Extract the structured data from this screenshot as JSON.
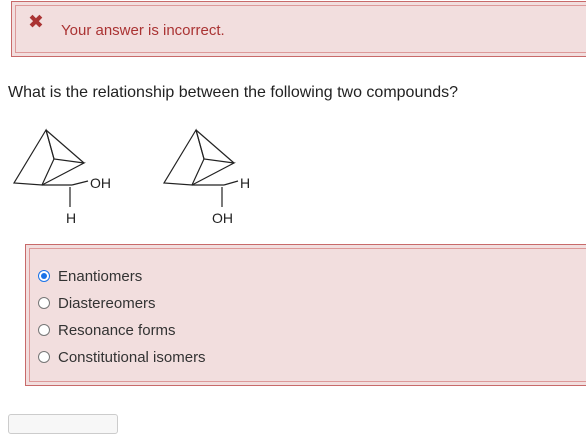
{
  "feedback": {
    "icon": "close-icon",
    "glyph": "✖",
    "text": "Your answer is incorrect."
  },
  "question": {
    "text": "What is the relationship between the following two compounds?"
  },
  "molecules": [
    {
      "top_label": "OH",
      "bottom_label": "H"
    },
    {
      "top_label": "H",
      "bottom_label": "OH"
    }
  ],
  "options": [
    {
      "label": "Enantiomers",
      "selected": true
    },
    {
      "label": "Diastereomers",
      "selected": false
    },
    {
      "label": "Resonance forms",
      "selected": false
    },
    {
      "label": "Constitutional isomers",
      "selected": false
    }
  ],
  "colors": {
    "error": "#aa3333",
    "accent": "#1a73e8",
    "error_bg": "#f2dede"
  }
}
